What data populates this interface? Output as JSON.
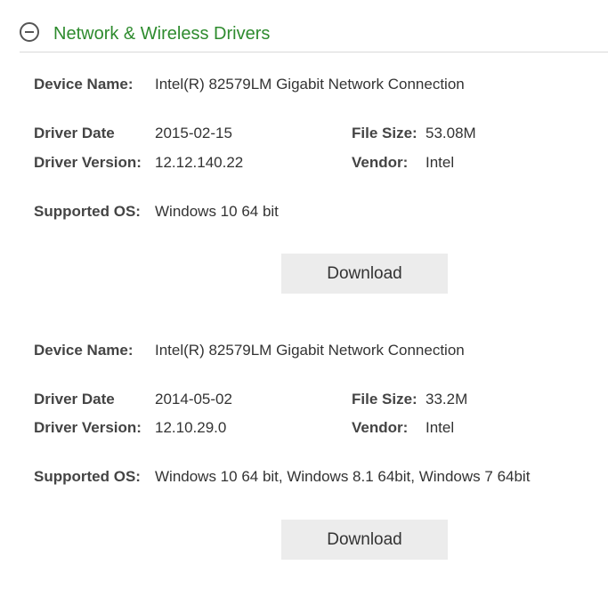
{
  "section": {
    "title": "Network & Wireless Drivers"
  },
  "labels": {
    "device_name": "Device Name:",
    "driver_date": "Driver Date",
    "driver_version": "Driver Version:",
    "file_size": "File Size:",
    "vendor": "Vendor:",
    "supported_os": "Supported OS:"
  },
  "drivers": [
    {
      "device_name": "Intel(R) 82579LM Gigabit Network Connection",
      "driver_date": "2015-02-15",
      "driver_version": "12.12.140.22",
      "file_size": "53.08M",
      "vendor": "Intel",
      "supported_os": "Windows 10 64 bit",
      "download_label": "Download"
    },
    {
      "device_name": "Intel(R) 82579LM Gigabit Network Connection",
      "driver_date": "2014-05-02",
      "driver_version": "12.10.29.0",
      "file_size": "33.2M",
      "vendor": "Intel",
      "supported_os": "Windows 10 64 bit, Windows 8.1 64bit, Windows 7 64bit",
      "download_label": "Download"
    }
  ]
}
